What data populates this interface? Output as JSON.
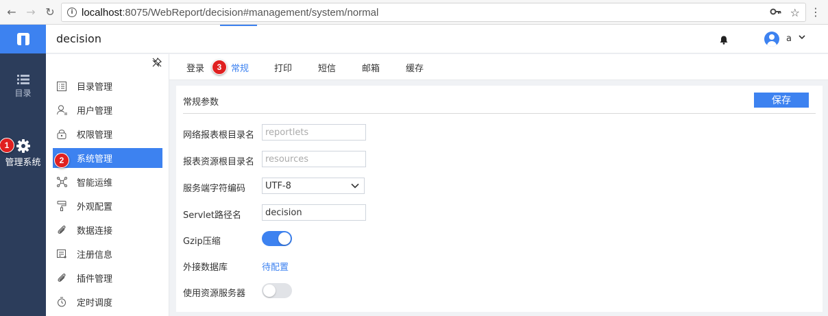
{
  "browser": {
    "url_host": "localhost",
    "url_rest": ":8075/WebReport/decision#management/system/normal"
  },
  "iconbar": {
    "items": [
      {
        "label": "目录",
        "icon": "list-icon"
      },
      {
        "label": "管理系统",
        "icon": "gear-icon"
      }
    ]
  },
  "header": {
    "title": "decision",
    "user": "a"
  },
  "sidebar": {
    "items": [
      {
        "label": "目录管理",
        "icon": "directory-icon"
      },
      {
        "label": "用户管理",
        "icon": "user-icon"
      },
      {
        "label": "权限管理",
        "icon": "lock-icon"
      },
      {
        "label": "系统管理",
        "icon": "system-icon"
      },
      {
        "label": "智能运维",
        "icon": "network-icon"
      },
      {
        "label": "外观配置",
        "icon": "paint-roller-icon"
      },
      {
        "label": "数据连接",
        "icon": "paperclip-icon"
      },
      {
        "label": "注册信息",
        "icon": "register-icon"
      },
      {
        "label": "插件管理",
        "icon": "plugin-icon"
      },
      {
        "label": "定时调度",
        "icon": "timer-icon"
      }
    ],
    "active_index": 3
  },
  "tabs": [
    {
      "label": "登录"
    },
    {
      "label": "常规"
    },
    {
      "label": "打印"
    },
    {
      "label": "短信"
    },
    {
      "label": "邮箱"
    },
    {
      "label": "缓存"
    }
  ],
  "panel": {
    "title": "常规参数",
    "save_label": "保存",
    "fields": {
      "report_root": {
        "label": "网络报表根目录名",
        "placeholder": "reportlets"
      },
      "resource_root": {
        "label": "报表资源根目录名",
        "placeholder": "resources"
      },
      "encoding": {
        "label": "服务端字符编码",
        "value": "UTF-8"
      },
      "servlet": {
        "label": "Servlet路径名",
        "value": "decision"
      },
      "gzip": {
        "label": "Gzip压缩",
        "on": true
      },
      "external_db": {
        "label": "外接数据库",
        "link": "待配置"
      },
      "resource_server": {
        "label": "使用资源服务器",
        "on": false
      }
    }
  },
  "annotations": [
    "1",
    "2",
    "3"
  ],
  "colors": {
    "accent": "#3d82f0",
    "iconbar_bg": "#2c3d5b",
    "badge": "#e02020"
  }
}
